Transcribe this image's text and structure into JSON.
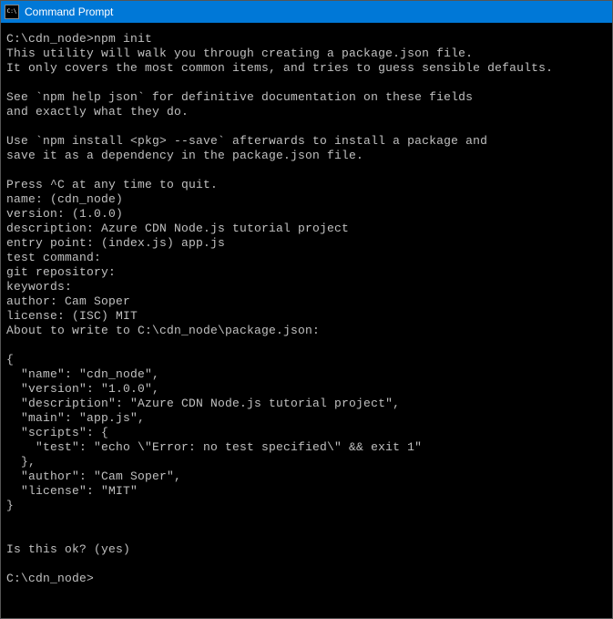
{
  "titlebar": {
    "title": "Command Prompt"
  },
  "terminal": {
    "lines": [
      "C:\\cdn_node>npm init",
      "This utility will walk you through creating a package.json file.",
      "It only covers the most common items, and tries to guess sensible defaults.",
      "",
      "See `npm help json` for definitive documentation on these fields",
      "and exactly what they do.",
      "",
      "Use `npm install <pkg> --save` afterwards to install a package and",
      "save it as a dependency in the package.json file.",
      "",
      "Press ^C at any time to quit.",
      "name: (cdn_node)",
      "version: (1.0.0)",
      "description: Azure CDN Node.js tutorial project",
      "entry point: (index.js) app.js",
      "test command:",
      "git repository:",
      "keywords:",
      "author: Cam Soper",
      "license: (ISC) MIT",
      "About to write to C:\\cdn_node\\package.json:",
      "",
      "{",
      "  \"name\": \"cdn_node\",",
      "  \"version\": \"1.0.0\",",
      "  \"description\": \"Azure CDN Node.js tutorial project\",",
      "  \"main\": \"app.js\",",
      "  \"scripts\": {",
      "    \"test\": \"echo \\\"Error: no test specified\\\" && exit 1\"",
      "  },",
      "  \"author\": \"Cam Soper\",",
      "  \"license\": \"MIT\"",
      "}",
      "",
      "",
      "Is this ok? (yes)",
      "",
      "C:\\cdn_node>"
    ]
  }
}
